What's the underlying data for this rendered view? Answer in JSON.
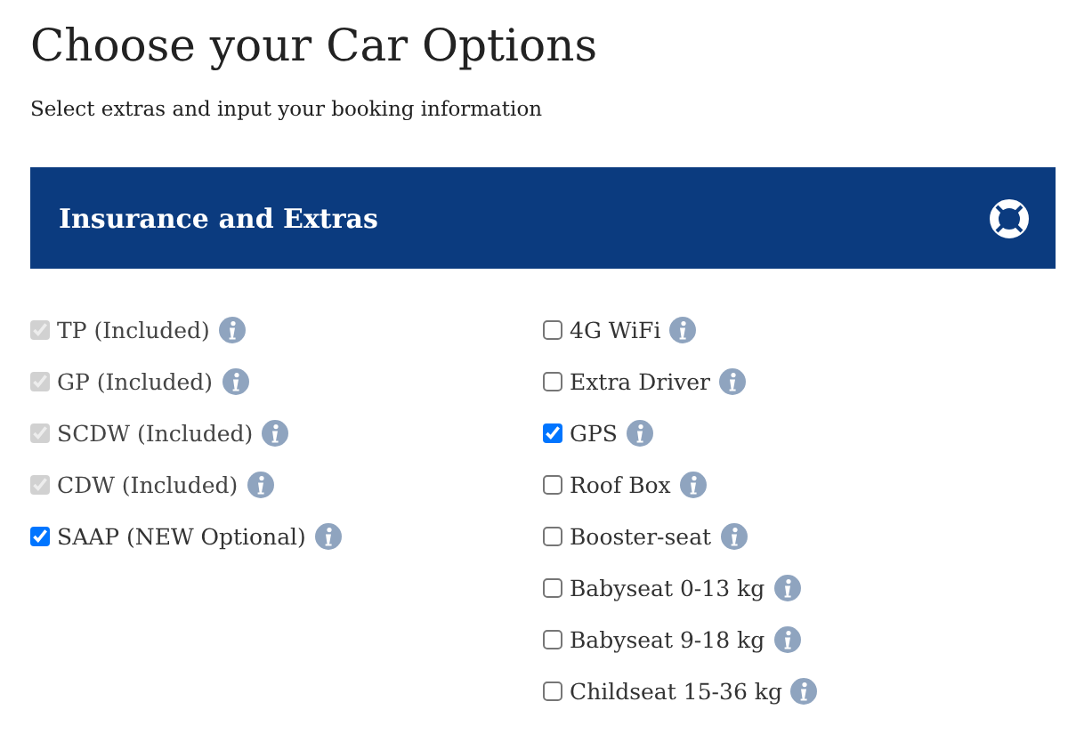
{
  "title": "Choose your Car Options",
  "subtitle": "Select extras and input your booking information",
  "panel": {
    "title": "Insurance and Extras"
  },
  "columns": [
    [
      {
        "label": "TP (Included)",
        "checked": true,
        "disabled": true
      },
      {
        "label": "GP (Included)",
        "checked": true,
        "disabled": true
      },
      {
        "label": "SCDW (Included)",
        "checked": true,
        "disabled": true
      },
      {
        "label": "CDW (Included)",
        "checked": true,
        "disabled": true
      },
      {
        "label": "SAAP (NEW Optional)",
        "checked": true,
        "disabled": false
      }
    ],
    [
      {
        "label": "4G WiFi",
        "checked": false,
        "disabled": false
      },
      {
        "label": "Extra Driver",
        "checked": false,
        "disabled": false
      },
      {
        "label": "GPS",
        "checked": true,
        "disabled": false
      },
      {
        "label": "Roof Box",
        "checked": false,
        "disabled": false
      },
      {
        "label": "Booster-seat",
        "checked": false,
        "disabled": false
      },
      {
        "label": "Babyseat 0-13 kg",
        "checked": false,
        "disabled": false
      },
      {
        "label": "Babyseat 9-18 kg",
        "checked": false,
        "disabled": false
      },
      {
        "label": "Childseat 15-36 kg",
        "checked": false,
        "disabled": false
      }
    ]
  ]
}
